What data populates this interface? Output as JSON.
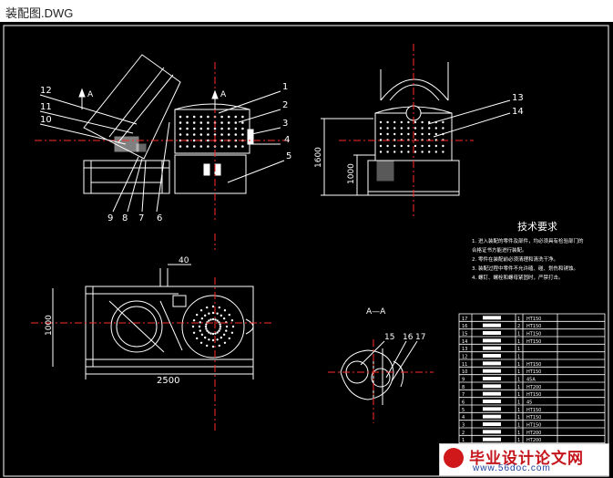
{
  "window": {
    "title": "装配图.DWG"
  },
  "drawing": {
    "section_marker": "A",
    "section_view_label": "A—A",
    "tech_title": "技术要求",
    "tech_notes": [
      "1. 进入装配的零件及部件，均必须具有检验部门的",
      "合格证书方能进行装配。",
      "2. 零件在装配前必须清理和清洗干净。",
      "3. 装配过程中零件不允许磕、碰、划伤和锈蚀。",
      "4. 螺钉、螺栓和螺母紧固时，严禁打击。"
    ],
    "dims": {
      "height_total": "1600",
      "height_base": "1000",
      "plan_height": "1000",
      "plan_length": "2500",
      "offset": "40"
    },
    "callouts_front": [
      "1",
      "2",
      "3",
      "4",
      "5",
      "6",
      "7",
      "8",
      "9",
      "10",
      "11",
      "12"
    ],
    "callouts_side": [
      "13",
      "14"
    ],
    "callouts_section": [
      "15",
      "16",
      "17"
    ],
    "bom": {
      "rows": [
        {
          "no": "17",
          "mat": "HT150"
        },
        {
          "no": "16",
          "mat": "HT150"
        },
        {
          "no": "15",
          "mat": "HT150"
        },
        {
          "no": "14",
          "mat": "HT150"
        },
        {
          "no": "13",
          "mat": ""
        },
        {
          "no": "12",
          "mat": ""
        },
        {
          "no": "11",
          "mat": "HT150"
        },
        {
          "no": "10",
          "mat": "HT150"
        },
        {
          "no": "9",
          "mat": "45A"
        },
        {
          "no": "8",
          "mat": "HT200"
        },
        {
          "no": "7",
          "mat": "HT150"
        },
        {
          "no": "6",
          "mat": "45"
        },
        {
          "no": "5",
          "mat": "HT150"
        },
        {
          "no": "4",
          "mat": "HT150"
        },
        {
          "no": "3",
          "mat": "HT150"
        },
        {
          "no": "2",
          "mat": "HT200"
        },
        {
          "no": "1",
          "mat": "HT200"
        }
      ],
      "qty": [
        "1",
        "2",
        "1",
        "1",
        "1",
        "1",
        "1",
        "1",
        "1",
        "1",
        "1",
        "1",
        "1",
        "1",
        "1",
        "1",
        "1"
      ]
    }
  },
  "watermark": {
    "name": "毕业设计论文网",
    "url": "www.56doc.com"
  }
}
